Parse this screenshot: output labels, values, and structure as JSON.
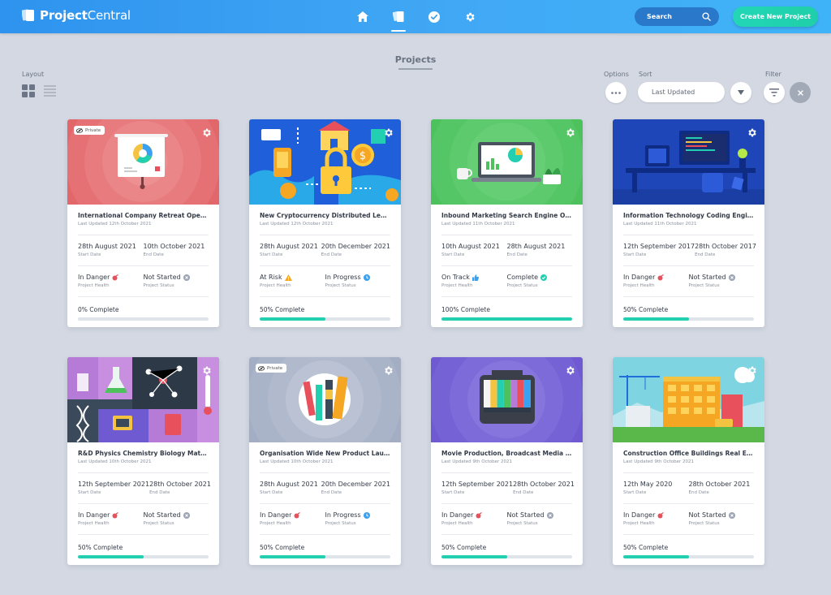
{
  "app": {
    "logo_part1": "Project",
    "logo_part2": "Central"
  },
  "header": {
    "nav": [
      "home-icon",
      "projects-icon",
      "tasks-icon",
      "settings-icon"
    ],
    "search_placeholder": "Search",
    "create_label": "Create New Project"
  },
  "toolbar": {
    "title": "Projects",
    "layout_label": "Layout",
    "options_label": "Options",
    "sort_label": "Sort",
    "sort_value": "Last Updated",
    "filter_label": "Filter"
  },
  "captions": {
    "start": "Start Date",
    "end": "End Date",
    "health": "Project Health",
    "status": "Project Status"
  },
  "private_label": "Private",
  "colors": {
    "accent": "#22cfb0",
    "danger": "#e8505b",
    "risk": "#f5a623",
    "progress": "#3aa0f0",
    "complete": "#22cfb0",
    "not_started": "#9aa4b4"
  },
  "projects": [
    {
      "title": "International Company Retreat Opening ...",
      "updated": "Last Updated 12th October 2021",
      "start": "28th August 2021",
      "end": "10th October 2021",
      "health": "In Danger",
      "status": "Not Started",
      "progress_label": "0% Complete",
      "progress": 0,
      "private": true,
      "theme": "presentation"
    },
    {
      "title": "New Cryptocurrency Distributed Ledger ...",
      "updated": "Last Updated 12th October 2021",
      "start": "28th August 2021",
      "end": "20th December 2021",
      "health": "At Risk",
      "status": "In Progress",
      "progress_label": "50% Complete",
      "progress": 50,
      "private": false,
      "theme": "crypto"
    },
    {
      "title": "Inbound Marketing Search Engine Optimi...",
      "updated": "Last Updated 11th October 2021",
      "start": "10th August 2021",
      "end": "28th August 2021",
      "health": "On Track",
      "status": "Complete",
      "progress_label": "100% Complete",
      "progress": 100,
      "private": false,
      "theme": "marketing"
    },
    {
      "title": "Information Technology Coding Engineering",
      "updated": "Last Updated 11th October 2021",
      "start": "12th September 2017",
      "end": "28th October 2017",
      "health": "In Danger",
      "status": "Not Started",
      "progress_label": "50% Complete",
      "progress": 50,
      "private": false,
      "theme": "it"
    },
    {
      "title": "R&D Physics Chemistry Biology Mathematics",
      "updated": "Last Updated 10th October 2021",
      "start": "12th September 2021",
      "end": "28th October 2021",
      "health": "In Danger",
      "status": "Not Started",
      "progress_label": "50% Complete",
      "progress": 50,
      "private": false,
      "theme": "science"
    },
    {
      "title": "Organisation Wide New Product Launch S...",
      "updated": "Last Updated 10th October 2021",
      "start": "28th August 2021",
      "end": "20th December 2021",
      "health": "In Danger",
      "status": "In Progress",
      "progress_label": "50% Complete",
      "progress": 50,
      "private": true,
      "theme": "product"
    },
    {
      "title": "Movie Production, Broadcast Media & Editing",
      "updated": "Last Updated 9th October 2021",
      "start": "12th September 2021",
      "end": "28th October 2021",
      "health": "In Danger",
      "status": "Not Started",
      "progress_label": "50% Complete",
      "progress": 50,
      "private": false,
      "theme": "media"
    },
    {
      "title": "Construction Office Buildings Real Estate",
      "updated": "Last Updated 9th October 2021",
      "start": "12th May 2020",
      "end": "28th October 2021",
      "health": "In Danger",
      "status": "Not Started",
      "progress_label": "50% Complete",
      "progress": 50,
      "private": false,
      "theme": "construction"
    }
  ]
}
